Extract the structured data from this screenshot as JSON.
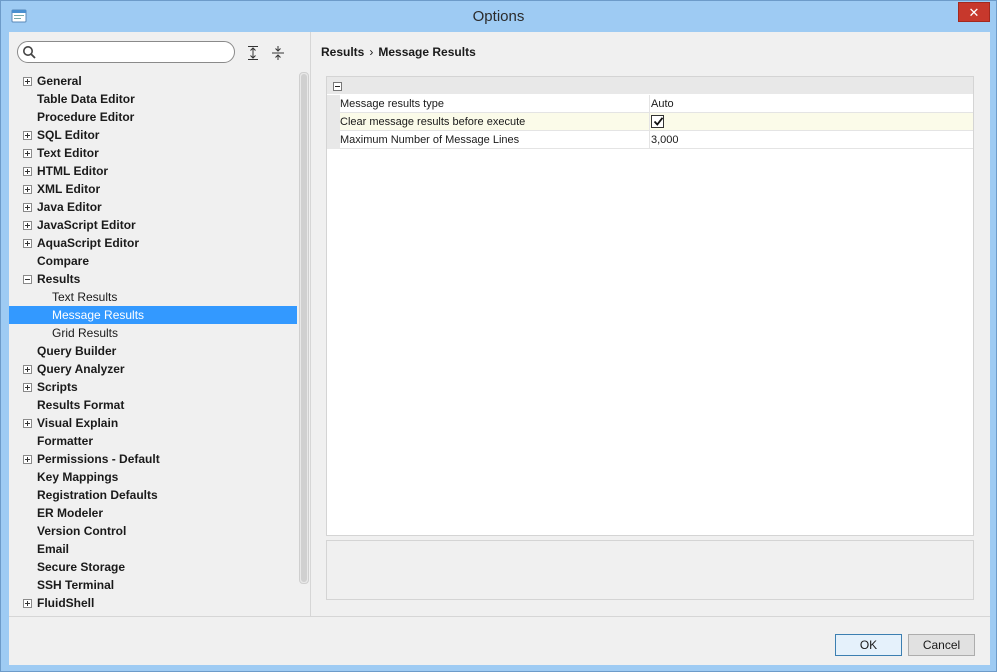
{
  "window": {
    "title": "Options",
    "close_label": "✕"
  },
  "search": {
    "placeholder": "",
    "value": ""
  },
  "tree": {
    "items": [
      {
        "label": "General",
        "expander": "plus",
        "bold": true,
        "level": 0
      },
      {
        "label": "Table Data Editor",
        "expander": "none",
        "bold": true,
        "level": 0
      },
      {
        "label": "Procedure Editor",
        "expander": "none",
        "bold": true,
        "level": 0
      },
      {
        "label": "SQL Editor",
        "expander": "plus",
        "bold": true,
        "level": 0
      },
      {
        "label": "Text Editor",
        "expander": "plus",
        "bold": true,
        "level": 0
      },
      {
        "label": "HTML Editor",
        "expander": "plus",
        "bold": true,
        "level": 0
      },
      {
        "label": "XML Editor",
        "expander": "plus",
        "bold": true,
        "level": 0
      },
      {
        "label": "Java Editor",
        "expander": "plus",
        "bold": true,
        "level": 0
      },
      {
        "label": "JavaScript Editor",
        "expander": "plus",
        "bold": true,
        "level": 0
      },
      {
        "label": "AquaScript Editor",
        "expander": "plus",
        "bold": true,
        "level": 0
      },
      {
        "label": "Compare",
        "expander": "none",
        "bold": true,
        "level": 0
      },
      {
        "label": "Results",
        "expander": "minus",
        "bold": true,
        "level": 0
      },
      {
        "label": "Text Results",
        "expander": "none",
        "bold": false,
        "level": 1
      },
      {
        "label": "Message Results",
        "expander": "none",
        "bold": false,
        "level": 1,
        "selected": true
      },
      {
        "label": "Grid Results",
        "expander": "none",
        "bold": false,
        "level": 1
      },
      {
        "label": "Query Builder",
        "expander": "none",
        "bold": true,
        "level": 0
      },
      {
        "label": "Query Analyzer",
        "expander": "plus",
        "bold": true,
        "level": 0
      },
      {
        "label": "Scripts",
        "expander": "plus",
        "bold": true,
        "level": 0
      },
      {
        "label": "Results Format",
        "expander": "none",
        "bold": true,
        "level": 0
      },
      {
        "label": "Visual Explain",
        "expander": "plus",
        "bold": true,
        "level": 0
      },
      {
        "label": "Formatter",
        "expander": "none",
        "bold": true,
        "level": 0
      },
      {
        "label": "Permissions - Default",
        "expander": "plus",
        "bold": true,
        "level": 0
      },
      {
        "label": "Key Mappings",
        "expander": "none",
        "bold": true,
        "level": 0
      },
      {
        "label": "Registration Defaults",
        "expander": "none",
        "bold": true,
        "level": 0
      },
      {
        "label": "ER Modeler",
        "expander": "none",
        "bold": true,
        "level": 0
      },
      {
        "label": "Version Control",
        "expander": "none",
        "bold": true,
        "level": 0
      },
      {
        "label": "Email",
        "expander": "none",
        "bold": true,
        "level": 0
      },
      {
        "label": "Secure Storage",
        "expander": "none",
        "bold": true,
        "level": 0
      },
      {
        "label": "SSH Terminal",
        "expander": "none",
        "bold": true,
        "level": 0
      },
      {
        "label": "FluidShell",
        "expander": "plus",
        "bold": true,
        "level": 0
      }
    ]
  },
  "breadcrumb": {
    "parent": "Results",
    "separator": "›",
    "current": "Message Results"
  },
  "properties": {
    "rows": [
      {
        "label": "Message results type",
        "value": "Auto",
        "type": "text"
      },
      {
        "label": "Clear message results before execute",
        "value": "true",
        "type": "checkbox"
      },
      {
        "label": "Maximum Number of Message Lines",
        "value": "3,000",
        "type": "text"
      }
    ]
  },
  "footer": {
    "ok_label": "OK",
    "cancel_label": "Cancel"
  },
  "colors": {
    "selection": "#3399ff",
    "title_bar": "#9ecbf3",
    "close": "#c7382c"
  }
}
